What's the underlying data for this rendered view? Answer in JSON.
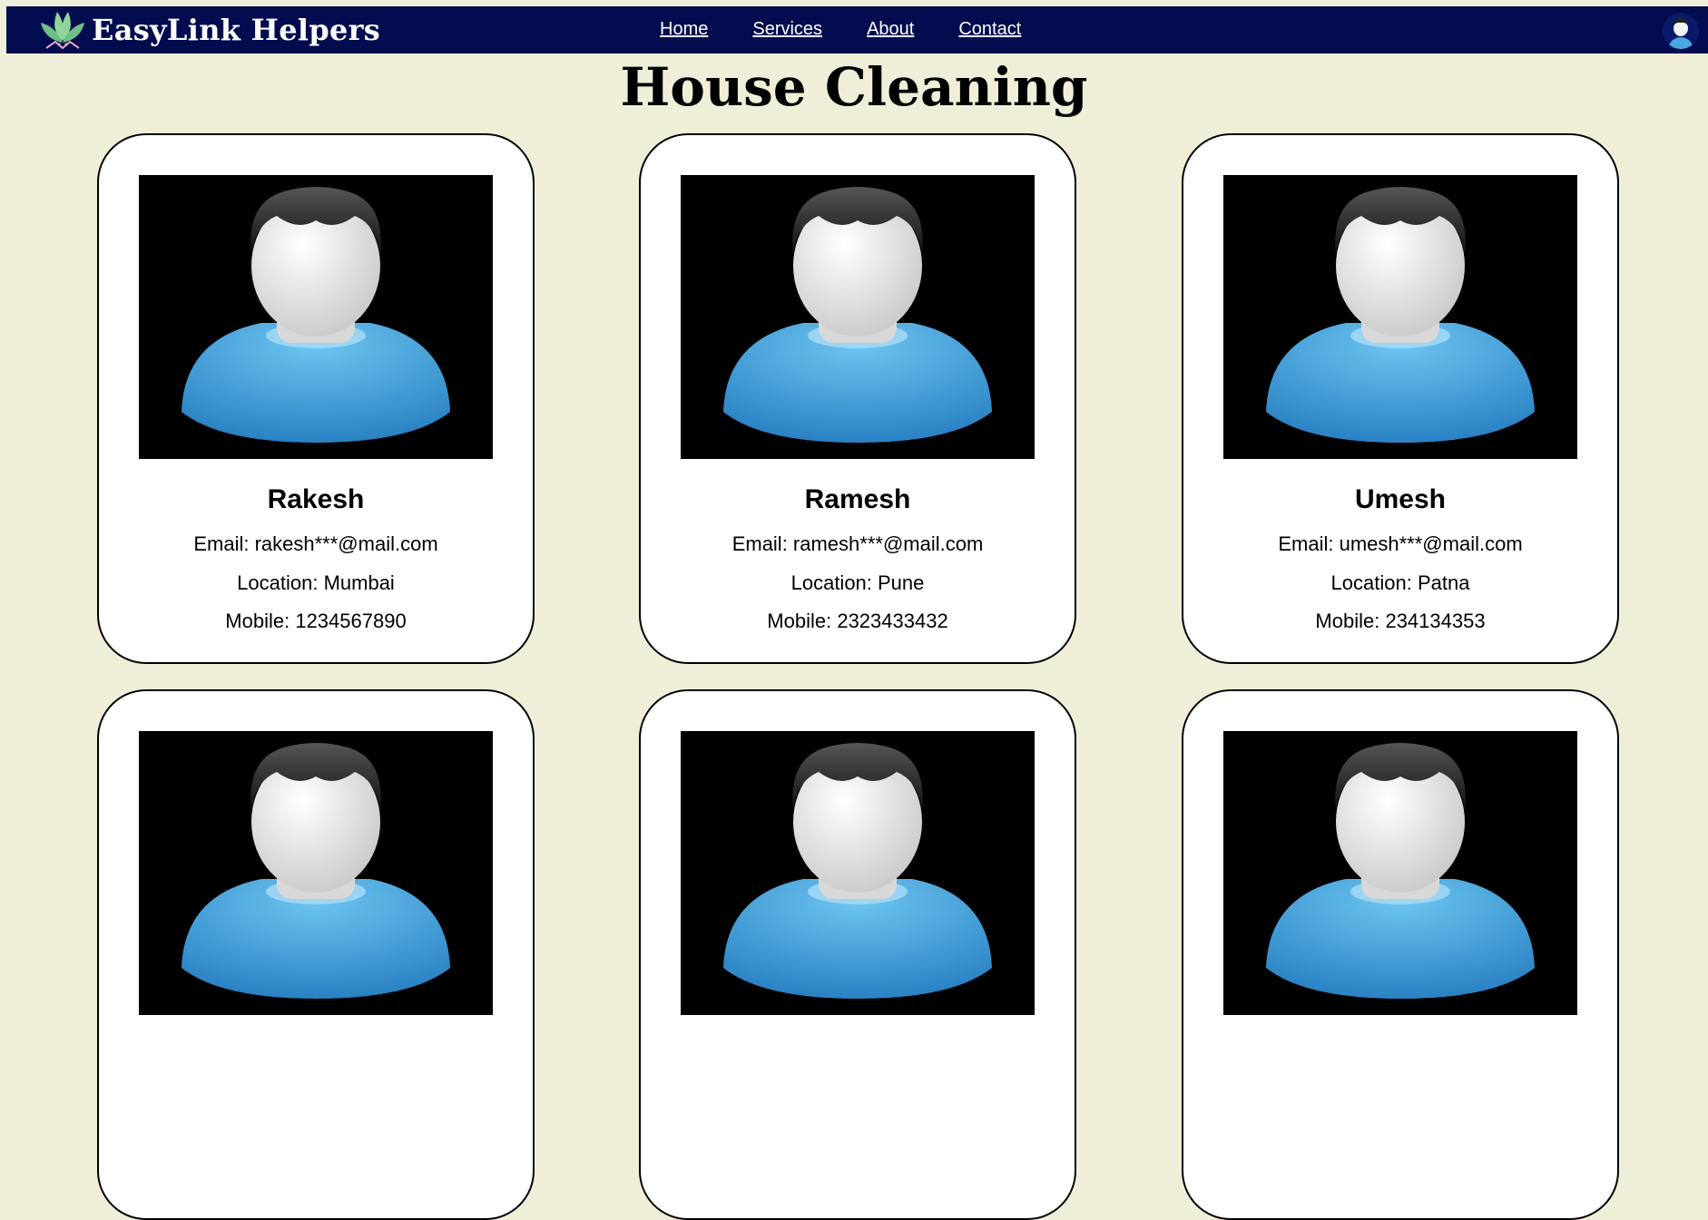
{
  "brand": {
    "name": "EasyLink Helpers"
  },
  "nav": {
    "links": [
      "Home",
      "Services",
      "About",
      "Contact"
    ]
  },
  "page": {
    "title": "House Cleaning"
  },
  "helpers": [
    {
      "name": "Rakesh",
      "email": "Email: rakesh***@mail.com",
      "location": "Location: Mumbai",
      "mobile": "Mobile: 1234567890"
    },
    {
      "name": "Ramesh",
      "email": "Email: ramesh***@mail.com",
      "location": "Location: Pune",
      "mobile": "Mobile: 2323433432"
    },
    {
      "name": "Umesh",
      "email": "Email: umesh***@mail.com",
      "location": "Location: Patna",
      "mobile": "Mobile: 234134353"
    }
  ],
  "icons": {
    "logo": "lotus-logo-icon",
    "profile": "user-avatar-icon",
    "photo": "person-placeholder-icon"
  },
  "colors": {
    "navbar": "#020c4f",
    "background": "#efeed8",
    "card": "#ffffff",
    "shirt": "#3b9ad9"
  }
}
